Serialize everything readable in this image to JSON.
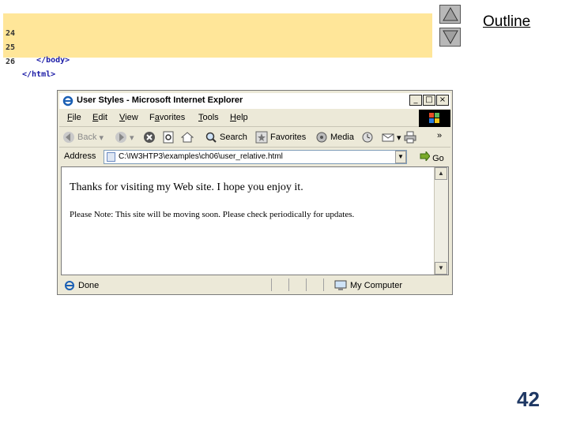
{
  "code": {
    "lines": [
      {
        "num": "24",
        "text": ""
      },
      {
        "num": "25",
        "text": "   </body>"
      },
      {
        "num": "26",
        "text": "</html>"
      }
    ],
    "background": "#ffe699"
  },
  "nav": {
    "up_icon": "triangle-up-icon",
    "down_icon": "triangle-down-icon",
    "outline_label": "Outline"
  },
  "browser": {
    "title": "User Styles - Microsoft Internet Explorer",
    "controls": {
      "minimize": "_",
      "maximize": "□",
      "close": "×"
    },
    "menu": [
      {
        "u": "F",
        "rest": "ile"
      },
      {
        "u": "E",
        "rest": "dit"
      },
      {
        "u": "V",
        "rest": "iew"
      },
      {
        "u": "",
        "pre": "F",
        "rest": "avorites",
        "label": "Favorites"
      },
      {
        "u": "T",
        "rest": "ools"
      },
      {
        "u": "H",
        "rest": "elp"
      }
    ],
    "toolbar": {
      "back": "Back",
      "search": "Search",
      "favorites": "Favorites",
      "media": "Media"
    },
    "address": {
      "label": "Address",
      "value": "C:\\IW3HTP3\\examples\\ch06\\user_relative.html",
      "go": "Go"
    },
    "content": {
      "paragraph1": "Thanks for visiting my Web site. I hope you enjoy it.",
      "paragraph2": "Please Note: This site will be moving soon. Please check periodically for updates."
    },
    "status": {
      "left": "Done",
      "zone": "My Computer"
    }
  },
  "page_number": "42"
}
